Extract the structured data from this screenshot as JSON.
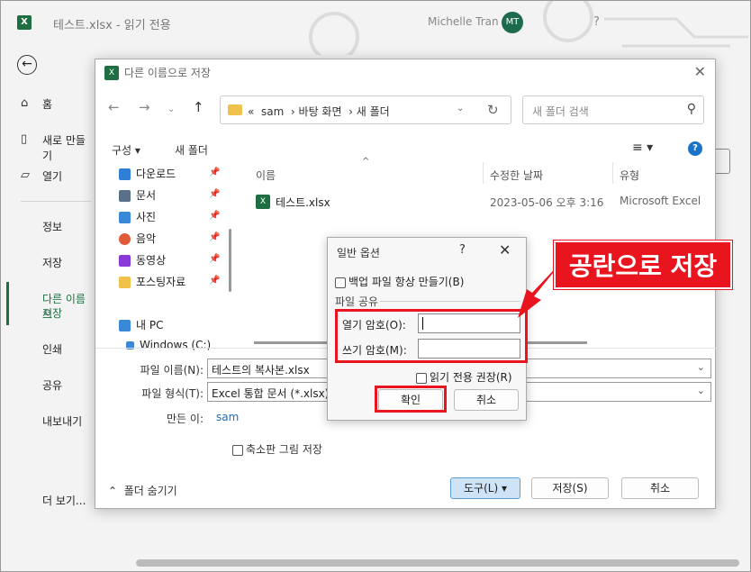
{
  "app": {
    "title": "테스트.xlsx  -  읽기 전용",
    "user_name": "Michelle Tran",
    "user_initials": "MT",
    "help": "?"
  },
  "backstage": {
    "items": [
      {
        "label": "홈",
        "icon": "home-icon"
      },
      {
        "label": "새로 만들기",
        "icon": "new-doc-icon"
      },
      {
        "label": "열기",
        "icon": "folder-open-icon"
      },
      {
        "label": "정보"
      },
      {
        "label": "저장"
      },
      {
        "label": "다른 이름으로 저장"
      },
      {
        "label": "인쇄"
      },
      {
        "label": "공유"
      },
      {
        "label": "내보내기"
      },
      {
        "label": "더 보기..."
      }
    ],
    "active_label_line1": "다른 이름으",
    "active_label_line2": "저장"
  },
  "save_dialog": {
    "title": "다른 이름으로 저장",
    "breadcrumb": {
      "prefix": "«",
      "parts": [
        "sam",
        "바탕 화면",
        "새 폴더"
      ]
    },
    "search_placeholder": "새 폴더 검색",
    "toolbar": {
      "organize": "구성",
      "new_folder": "새 폴더"
    },
    "sidebar": [
      {
        "label": "다운로드",
        "color": "#2f7fd8"
      },
      {
        "label": "문서",
        "color": "#5a6f8a"
      },
      {
        "label": "사진",
        "color": "#3a88d8"
      },
      {
        "label": "음악",
        "color": "#e05a3a"
      },
      {
        "label": "동영상",
        "color": "#8a3ad8"
      },
      {
        "label": "포스팅자료",
        "color": "#f0c24c"
      },
      {
        "label": "내 PC",
        "color": "#3a88d8"
      },
      {
        "label": "Windows (C:)",
        "color": "#3a88d8"
      }
    ],
    "columns": {
      "name": "이름",
      "modified": "수정한 날짜",
      "type": "유형"
    },
    "files": [
      {
        "name": "테스트.xlsx",
        "modified": "2023-05-06 오후 3:16",
        "type": "Microsoft Excel"
      }
    ],
    "file_name_label": "파일 이름(N):",
    "file_name_value": "테스트의 복사본.xlsx",
    "file_type_label": "파일 형식(T):",
    "file_type_value": "Excel 통합 문서 (*.xlsx)",
    "author_label": "만든 이:",
    "author_value": "sam",
    "thumbnail_label": "축소판 그림 저장",
    "hide_folders": "폴더 숨기기",
    "tools_button": "도구(L)",
    "save_button": "저장(S)",
    "cancel_button": "취소"
  },
  "options_dialog": {
    "title": "일반 옵션",
    "help": "?",
    "backup_label": "백업 파일 항상 만들기(B)",
    "group_label": "파일 공유",
    "open_password_label": "열기 암호(O):",
    "write_password_label": "쓰기 암호(M):",
    "read_only_label": "읽기 전용 권장(R)",
    "ok_button": "확인",
    "cancel_button": "취소"
  },
  "annotation": {
    "text": "공란으로 저장",
    "color": "#e8141e"
  }
}
